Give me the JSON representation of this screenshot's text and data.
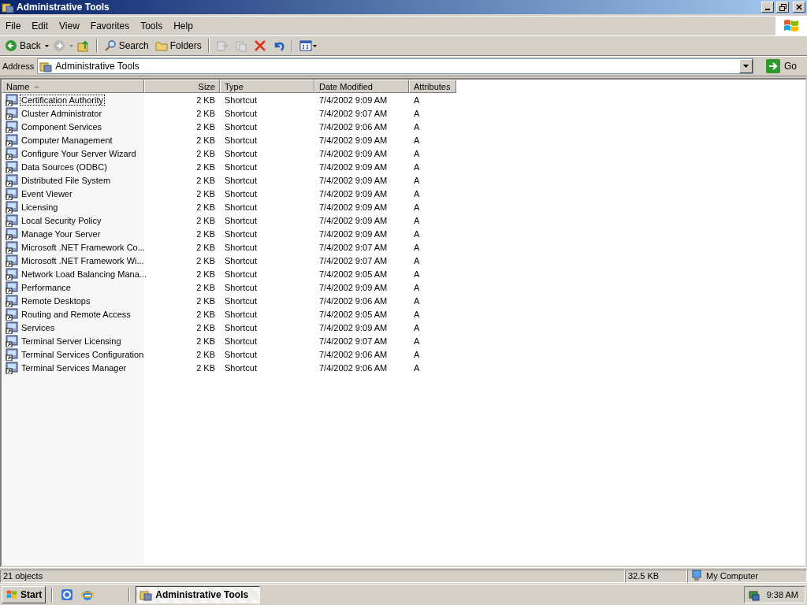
{
  "window": {
    "title": "Administrative Tools"
  },
  "menu": [
    "File",
    "Edit",
    "View",
    "Favorites",
    "Tools",
    "Help"
  ],
  "toolbar": {
    "back": "Back",
    "search": "Search",
    "folders": "Folders"
  },
  "address": {
    "label": "Address",
    "value": "Administrative Tools",
    "go": "Go"
  },
  "columns": [
    {
      "label": "Name",
      "sorted": true
    },
    {
      "label": "Size",
      "sorted": false
    },
    {
      "label": "Type",
      "sorted": false
    },
    {
      "label": "Date Modified",
      "sorted": false
    },
    {
      "label": "Attributes",
      "sorted": false
    }
  ],
  "rows": [
    {
      "name": "Certification Authority",
      "size": "2 KB",
      "type": "Shortcut",
      "date": "7/4/2002 9:09 AM",
      "attributes": "A",
      "focused": true
    },
    {
      "name": "Cluster Administrator",
      "size": "2 KB",
      "type": "Shortcut",
      "date": "7/4/2002 9:07 AM",
      "attributes": "A",
      "focused": false
    },
    {
      "name": "Component Services",
      "size": "2 KB",
      "type": "Shortcut",
      "date": "7/4/2002 9:06 AM",
      "attributes": "A",
      "focused": false
    },
    {
      "name": "Computer Management",
      "size": "2 KB",
      "type": "Shortcut",
      "date": "7/4/2002 9:09 AM",
      "attributes": "A",
      "focused": false
    },
    {
      "name": "Configure Your Server Wizard",
      "size": "2 KB",
      "type": "Shortcut",
      "date": "7/4/2002 9:09 AM",
      "attributes": "A",
      "focused": false
    },
    {
      "name": "Data Sources (ODBC)",
      "size": "2 KB",
      "type": "Shortcut",
      "date": "7/4/2002 9:09 AM",
      "attributes": "A",
      "focused": false
    },
    {
      "name": "Distributed File System",
      "size": "2 KB",
      "type": "Shortcut",
      "date": "7/4/2002 9:09 AM",
      "attributes": "A",
      "focused": false
    },
    {
      "name": "Event Viewer",
      "size": "2 KB",
      "type": "Shortcut",
      "date": "7/4/2002 9:09 AM",
      "attributes": "A",
      "focused": false
    },
    {
      "name": "Licensing",
      "size": "2 KB",
      "type": "Shortcut",
      "date": "7/4/2002 9:09 AM",
      "attributes": "A",
      "focused": false
    },
    {
      "name": "Local Security Policy",
      "size": "2 KB",
      "type": "Shortcut",
      "date": "7/4/2002 9:09 AM",
      "attributes": "A",
      "focused": false
    },
    {
      "name": "Manage Your Server",
      "size": "2 KB",
      "type": "Shortcut",
      "date": "7/4/2002 9:09 AM",
      "attributes": "A",
      "focused": false
    },
    {
      "name": "Microsoft .NET Framework Co...",
      "size": "2 KB",
      "type": "Shortcut",
      "date": "7/4/2002 9:07 AM",
      "attributes": "A",
      "focused": false
    },
    {
      "name": "Microsoft .NET Framework Wi...",
      "size": "2 KB",
      "type": "Shortcut",
      "date": "7/4/2002 9:07 AM",
      "attributes": "A",
      "focused": false
    },
    {
      "name": "Network Load Balancing Mana...",
      "size": "2 KB",
      "type": "Shortcut",
      "date": "7/4/2002 9:05 AM",
      "attributes": "A",
      "focused": false
    },
    {
      "name": "Performance",
      "size": "2 KB",
      "type": "Shortcut",
      "date": "7/4/2002 9:09 AM",
      "attributes": "A",
      "focused": false
    },
    {
      "name": "Remote Desktops",
      "size": "2 KB",
      "type": "Shortcut",
      "date": "7/4/2002 9:06 AM",
      "attributes": "A",
      "focused": false
    },
    {
      "name": "Routing and Remote Access",
      "size": "2 KB",
      "type": "Shortcut",
      "date": "7/4/2002 9:05 AM",
      "attributes": "A",
      "focused": false
    },
    {
      "name": "Services",
      "size": "2 KB",
      "type": "Shortcut",
      "date": "7/4/2002 9:09 AM",
      "attributes": "A",
      "focused": false
    },
    {
      "name": "Terminal Server Licensing",
      "size": "2 KB",
      "type": "Shortcut",
      "date": "7/4/2002 9:07 AM",
      "attributes": "A",
      "focused": false
    },
    {
      "name": "Terminal Services Configuration",
      "size": "2 KB",
      "type": "Shortcut",
      "date": "7/4/2002 9:06 AM",
      "attributes": "A",
      "focused": false
    },
    {
      "name": "Terminal Services Manager",
      "size": "2 KB",
      "type": "Shortcut",
      "date": "7/4/2002 9:06 AM",
      "attributes": "A",
      "focused": false
    }
  ],
  "status_bar": {
    "objects": "21 objects",
    "size": "32.5 KB",
    "zone": "My Computer"
  },
  "taskbar": {
    "start": "Start",
    "tasks": [
      {
        "label": "Administrative Tools",
        "selected": true
      }
    ],
    "clock": "9:38 AM"
  }
}
